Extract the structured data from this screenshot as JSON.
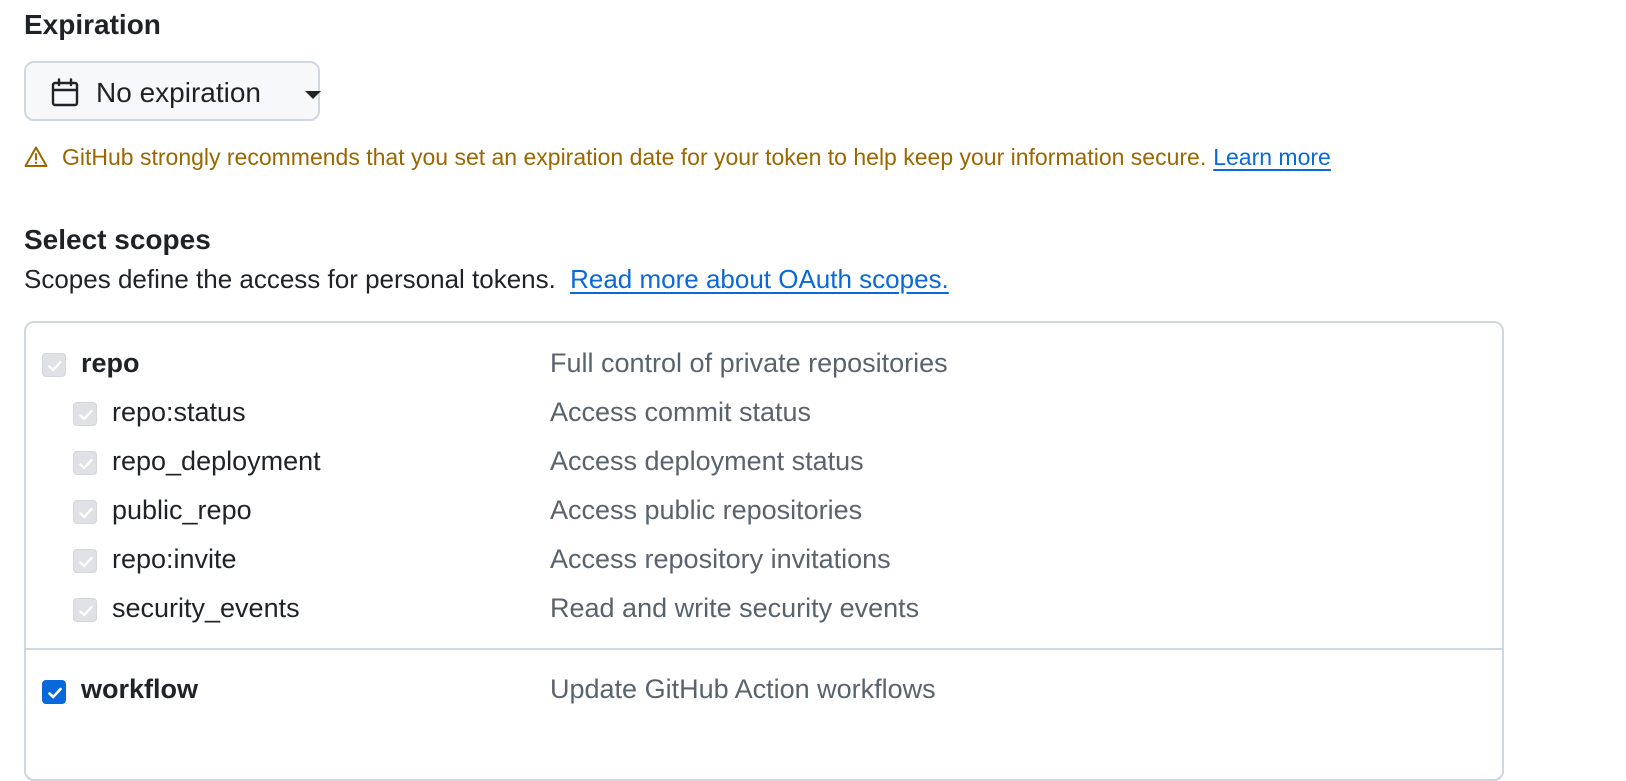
{
  "expiration": {
    "heading": "Expiration",
    "selected": "No expiration",
    "icon": "calendar-icon"
  },
  "warning": {
    "text": "GitHub strongly recommends that you set an expiration date for your token to help keep your information secure.",
    "link": "Learn more",
    "color": "#9a6700",
    "icon": "alert-icon"
  },
  "scopes": {
    "heading": "Select scopes",
    "description": "Scopes define the access for personal tokens.",
    "link": "Read more about OAuth scopes.",
    "items": [
      {
        "name": "repo",
        "description": "Full control of private repositories",
        "checked": true,
        "disabled": true
      },
      {
        "name": "repo:status",
        "description": "Access commit status",
        "checked": true,
        "disabled": true
      },
      {
        "name": "repo_deployment",
        "description": "Access deployment status",
        "checked": true,
        "disabled": true
      },
      {
        "name": "public_repo",
        "description": "Access public repositories",
        "checked": true,
        "disabled": true
      },
      {
        "name": "repo:invite",
        "description": "Access repository invitations",
        "checked": true,
        "disabled": true
      },
      {
        "name": "security_events",
        "description": "Read and write security events",
        "checked": true,
        "disabled": true
      },
      {
        "name": "workflow",
        "description": "Update GitHub Action workflows",
        "checked": true,
        "disabled": false
      }
    ]
  },
  "colors": {
    "accent": "#0969da",
    "warning": "#9a6700",
    "border": "#d0d7de",
    "muted": "#59636e"
  }
}
